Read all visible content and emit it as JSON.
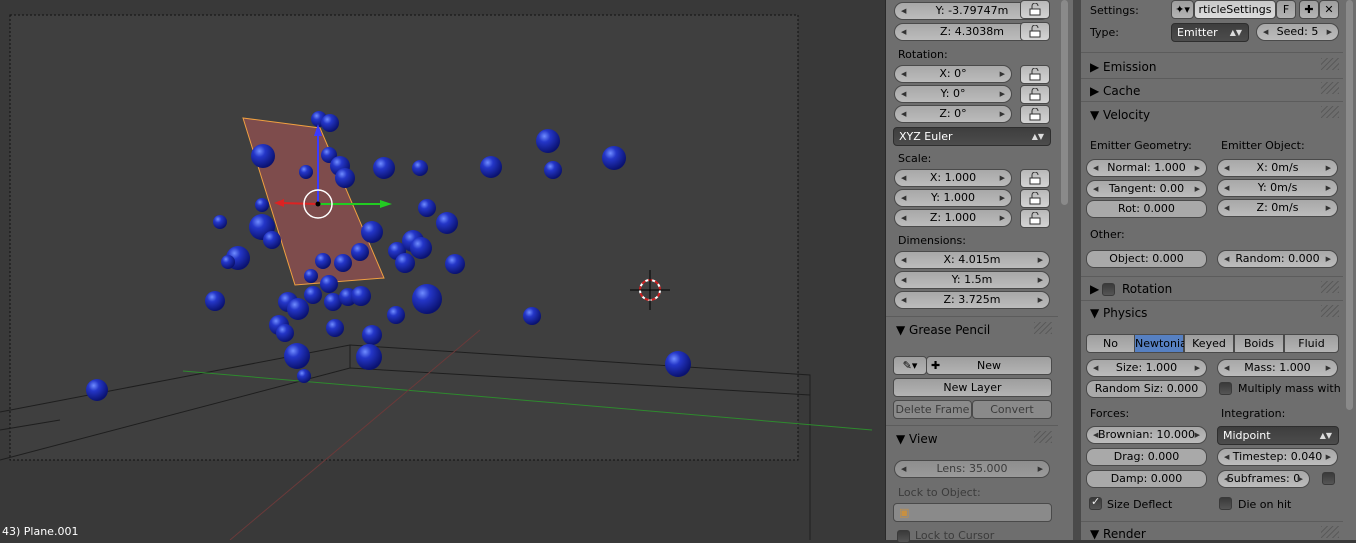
{
  "viewport": {
    "status": "43) Plane.001"
  },
  "npanel": {
    "location": {
      "y": "Y: -3.79747m",
      "z": "Z: 4.3038m"
    },
    "rotation": {
      "label": "Rotation:",
      "x": "X: 0°",
      "y": "Y: 0°",
      "z": "Z: 0°",
      "mode": "XYZ Euler"
    },
    "scale": {
      "label": "Scale:",
      "x": "X: 1.000",
      "y": "Y: 1.000",
      "z": "Z: 1.000"
    },
    "dimensions": {
      "label": "Dimensions:",
      "x": "X: 4.015m",
      "y": "Y: 1.5m",
      "z": "Z: 3.725m"
    },
    "grease_pencil": {
      "title": "Grease Pencil",
      "new": "New",
      "new_layer": "New Layer",
      "delete_frame": "Delete Frame",
      "convert": "Convert"
    },
    "view": {
      "title": "View",
      "lens": "Lens: 35.000",
      "lock_to_object": "Lock to Object:",
      "lock_to_cursor": "Lock to Cursor"
    }
  },
  "props": {
    "settings_label": "Settings:",
    "settings_name": "rticleSettings",
    "settings_f": "F",
    "type_label": "Type:",
    "type_value": "Emitter",
    "seed": "Seed: 5",
    "panels": {
      "emission": "Emission",
      "cache": "Cache",
      "velocity": "Velocity",
      "rotation": "Rotation",
      "physics": "Physics",
      "render": "Render"
    },
    "velocity": {
      "emitter_geometry": "Emitter Geometry:",
      "emitter_object": "Emitter Object:",
      "normal": "Normal: 1.000",
      "tangent": "Tangent: 0.00",
      "rot": "Rot: 0.000",
      "ex": "X: 0m/s",
      "ey": "Y: 0m/s",
      "ez": "Z: 0m/s",
      "other": "Other:",
      "object": "Object: 0.000",
      "random": "Random: 0.000"
    },
    "physics": {
      "types": [
        "No",
        "Newtonia",
        "Keyed",
        "Boids",
        "Fluid"
      ],
      "active": "Newtonia",
      "size": "Size: 1.000",
      "random_size": "Random Siz: 0.000",
      "mass": "Mass: 1.000",
      "multiply_mass": "Multiply mass with",
      "forces": "Forces:",
      "integration": "Integration:",
      "brownian": "Brownian: 10.000",
      "drag": "Drag: 0.000",
      "damp": "Damp: 0.000",
      "integration_value": "Midpoint",
      "timestep": "Timestep: 0.040",
      "subframes": "Subframes: 0",
      "size_deflect": "Size Deflect",
      "die_on_hit": "Die on hit"
    }
  },
  "colors": {
    "accent": "#5680c2",
    "particle": "#1a2fb0",
    "plane": "#8a4f4f",
    "plane_outline": "#f0a040"
  }
}
